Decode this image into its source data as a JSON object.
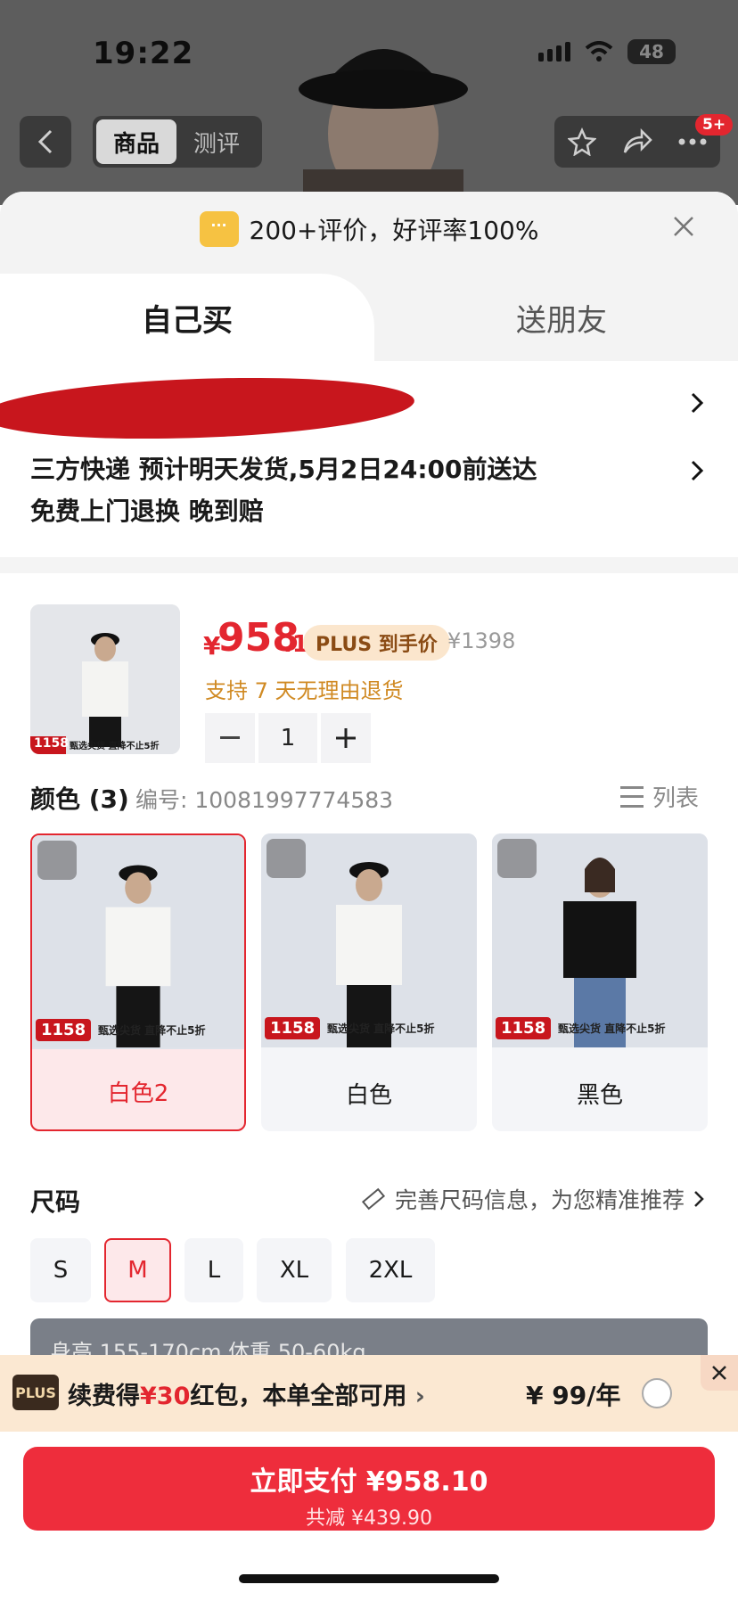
{
  "status_bar": {
    "time": "19:22",
    "battery": "48"
  },
  "header": {
    "tabs": [
      {
        "label": "商品"
      },
      {
        "label": "测评"
      }
    ],
    "notification_badge": "5+"
  },
  "sheet": {
    "review_summary": "200+评价，好评率100%",
    "purchase_tabs": {
      "self": "自己买",
      "gift": "送朋友"
    },
    "shipping_line1": "三方快递 预计明天发货,5月2日24:00前送达",
    "shipping_line2": "免费上门退换  晚到赔"
  },
  "product": {
    "price_symbol": "¥",
    "price_int": "958",
    "price_dec": ".1",
    "plus_tag": "PLUS 到手价",
    "original_price": "¥1398",
    "return_policy": "支持 7 天无理由退货",
    "quantity": "1",
    "thumb_price": "1158",
    "thumb_promo": "甄选尖货 直降不止5折"
  },
  "color": {
    "title": "颜色 (3)",
    "code": "编号: 10081997774583",
    "list_label": "列表",
    "options": [
      {
        "label": "白色2",
        "price": "1158",
        "promo": "甄选尖货 直降不止5折",
        "selected": true
      },
      {
        "label": "白色",
        "price": "1158",
        "promo": "甄选尖货 直降不止5折",
        "selected": false
      },
      {
        "label": "黑色",
        "price": "1158",
        "promo": "甄选尖货 直降不止5折",
        "selected": false
      }
    ]
  },
  "size": {
    "title": "尺码",
    "hint": "完善尺码信息，为您精准推荐",
    "options": [
      "S",
      "M",
      "L",
      "XL",
      "2XL"
    ],
    "selected": "M",
    "info_text": "身高 155-170cm    体重 50-60kg"
  },
  "plus_bar": {
    "logo": "PLUS",
    "text_pre": "续费得",
    "text_amount": "¥30",
    "text_post": "红包，本单全部可用",
    "price": "¥ 99/年"
  },
  "pay": {
    "main": "立即支付 ¥958.10",
    "sub": "共减 ¥439.90"
  },
  "colors": {
    "accent_red": "#e3262f",
    "pay_button": "#ee2d3c",
    "plus_bar_bg": "#fbe8d2"
  }
}
